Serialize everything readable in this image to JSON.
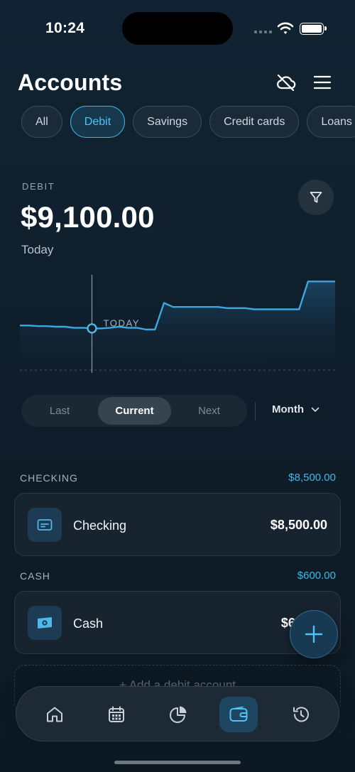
{
  "status_bar": {
    "time": "10:24"
  },
  "header": {
    "title": "Accounts",
    "cloud_icon": "cloud-off-icon",
    "menu_icon": "hamburger-menu-icon"
  },
  "filter_chips": [
    {
      "label": "All",
      "active": false
    },
    {
      "label": "Debit",
      "active": true
    },
    {
      "label": "Savings",
      "active": false
    },
    {
      "label": "Credit cards",
      "active": false
    },
    {
      "label": "Loans",
      "active": false
    }
  ],
  "summary": {
    "kind": "DEBIT",
    "balance": "$9,100.00",
    "period": "Today",
    "filter_icon": "filter-icon"
  },
  "chart_data": {
    "type": "area",
    "marker_label": "TODAY",
    "series": [
      {
        "values": [
          8200,
          8200,
          8190,
          8190,
          8180,
          8180,
          8160,
          8160,
          8150,
          8150,
          8160,
          8180,
          8160,
          8160,
          8130,
          8130,
          8590,
          8520,
          8520,
          8520,
          8520,
          8520,
          8520,
          8500,
          8500,
          8500,
          8480,
          8480,
          8480,
          8480,
          8480,
          8480,
          8960,
          8960,
          8960,
          8960
        ]
      }
    ],
    "today_index": 8,
    "colors": {
      "line": "#3fa7e0",
      "fill_top": "#1c4868",
      "fill_bottom": "#0f1e2b"
    }
  },
  "range_control": {
    "options": [
      "Last",
      "Current",
      "Next"
    ],
    "selected": "Current",
    "granularity": "Month"
  },
  "groups": [
    {
      "title": "CHECKING",
      "total": "$8,500.00",
      "accounts": [
        {
          "name": "Checking",
          "amount": "$8,500.00",
          "icon": "card-icon"
        }
      ]
    },
    {
      "title": "CASH",
      "total": "$600.00",
      "accounts": [
        {
          "name": "Cash",
          "amount": "$600.00",
          "icon": "banknote-icon"
        }
      ]
    }
  ],
  "add_account": {
    "label": "+ Add a debit account"
  },
  "tab_bar": [
    {
      "icon": "home-icon",
      "active": false
    },
    {
      "icon": "calendar-icon",
      "active": false
    },
    {
      "icon": "pie-chart-icon",
      "active": false
    },
    {
      "icon": "wallet-icon",
      "active": true
    },
    {
      "icon": "history-icon",
      "active": false
    }
  ],
  "colors": {
    "accent": "#3fb7e8",
    "background": "#0f1e2b",
    "card": "#172430"
  }
}
